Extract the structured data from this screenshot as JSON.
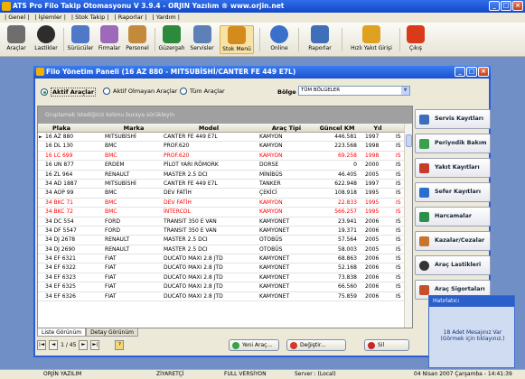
{
  "app": {
    "title": "ATS Pro Filo Takip Otomasyonu V 3.9.4 - ORJIN Yazılım ® www.orjin.net"
  },
  "window_buttons": [
    "_",
    "□",
    "×"
  ],
  "menu": [
    "| Genel |",
    "| İşlemler |",
    "| Stok Takip |",
    "| Raporlar |",
    "| Yardım |"
  ],
  "toolbar": [
    {
      "label": "Araçlar",
      "color": "#6e6e6e"
    },
    {
      "label": "Lastikler",
      "color": "#2d2d2d"
    },
    {
      "label": "Sürücüler",
      "color": "#4f79c8"
    },
    {
      "label": "Firmalar",
      "color": "#9c6ab8"
    },
    {
      "label": "Personel",
      "color": "#c48a3c"
    },
    {
      "label": "Güzergah",
      "color": "#2d8a3c"
    },
    {
      "label": "Servisler",
      "color": "#5d80b7"
    },
    {
      "label": "Stok Menü",
      "color": "#d48b1e"
    },
    {
      "label": "Online",
      "color": "#3a70c9"
    },
    {
      "label": "Raporlar",
      "color": "#3f6fb8"
    },
    {
      "label": "Hızlı Yakıt Girişi",
      "color": "#e0a020"
    },
    {
      "label": "Çıkış",
      "color": "#d83a1a"
    }
  ],
  "panel": {
    "title": "Filo Yönetim Paneli (16 AZ 880 - MITSUBİSHİ/CANTER FE 449 E7L)"
  },
  "filter": {
    "options": [
      "Aktif Araçlar",
      "Aktif Olmayan Araçlar",
      "Tüm Araçlar"
    ],
    "selected": "Aktif Araçlar",
    "bolge_label": "Bölge",
    "bolge_value": "TÜM BÖLGELER"
  },
  "grid": {
    "group_hint": "Gruplamak istediğiniz kolonu buraya sürükleyin",
    "columns": [
      "Plaka",
      "Marka",
      "Model",
      "Araç Tipi",
      "Güncel KM",
      "Yıl",
      ""
    ],
    "rows": [
      {
        "plaka": "16 AZ 880",
        "marka": "MITSUBİSHİ",
        "model": "CANTER FE 449 E7L",
        "tip": "KAMYON",
        "km": "446.581",
        "yil": "1997",
        "x": "IS",
        "red": false
      },
      {
        "plaka": "16 DL 130",
        "marka": "BMC",
        "model": "PROF.620",
        "tip": "KAMYON",
        "km": "223.568",
        "yil": "1998",
        "x": "IS",
        "red": false
      },
      {
        "plaka": "16 LC 699",
        "marka": "BMC",
        "model": "PROF.620",
        "tip": "KAMYON",
        "km": "69.258",
        "yil": "1998",
        "x": "IS",
        "red": true
      },
      {
        "plaka": "16 UN 877",
        "marka": "ERDEM",
        "model": "PİLOT YARI RÖMORK",
        "tip": "DORSE",
        "km": "0",
        "yil": "2000",
        "x": "IS",
        "red": false
      },
      {
        "plaka": "16 ZL 964",
        "marka": "RENAULT",
        "model": "MASTER 2.5 DCI",
        "tip": "MİNİBÜS",
        "km": "46.405",
        "yil": "2005",
        "x": "IS",
        "red": false
      },
      {
        "plaka": "34 AD 1887",
        "marka": "MITSUBİSHİ",
        "model": "CANTER FE 449 E7L",
        "tip": "TANKER",
        "km": "622.948",
        "yil": "1997",
        "x": "IS",
        "red": false
      },
      {
        "plaka": "34 AOP 99",
        "marka": "BMC",
        "model": "DEV FATİH",
        "tip": "ÇEKİCİ",
        "km": "108.918",
        "yil": "1995",
        "x": "IS",
        "red": false
      },
      {
        "plaka": "34 BKC 71",
        "marka": "BMC",
        "model": "DEV FATİH",
        "tip": "KAMYON",
        "km": "22.833",
        "yil": "1995",
        "x": "IS",
        "red": true
      },
      {
        "plaka": "34 BKC 72",
        "marka": "BMC",
        "model": "İNTERCOL",
        "tip": "KAMYON",
        "km": "566.257",
        "yil": "1995",
        "x": "IS",
        "red": true
      },
      {
        "plaka": "34 DC 554",
        "marka": "FORD",
        "model": "TRANSIT 350 E VAN",
        "tip": "KAMYONET",
        "km": "23.941",
        "yil": "2006",
        "x": "IS",
        "red": false
      },
      {
        "plaka": "34 DF 5547",
        "marka": "FORD",
        "model": "TRANSIT 350 E VAN",
        "tip": "KAMYONET",
        "km": "19.371",
        "yil": "2006",
        "x": "IS",
        "red": false
      },
      {
        "plaka": "34 DJ 2678",
        "marka": "RENAULT",
        "model": "MASTER 2.5 DCI",
        "tip": "OTOBÜS",
        "km": "57.564",
        "yil": "2005",
        "x": "IS",
        "red": false
      },
      {
        "plaka": "34 DJ 2690",
        "marka": "RENAULT",
        "model": "MASTER 2.5 DCI",
        "tip": "OTOBÜS",
        "km": "58.003",
        "yil": "2005",
        "x": "IS",
        "red": false
      },
      {
        "plaka": "34 EF 6321",
        "marka": "FIAT",
        "model": "DUCATO MAXI 2.8 JTD",
        "tip": "KAMYONET",
        "km": "68.863",
        "yil": "2006",
        "x": "IS",
        "red": false
      },
      {
        "plaka": "34 EF 6322",
        "marka": "FIAT",
        "model": "DUCATO MAXI 2.8 JTD",
        "tip": "KAMYONET",
        "km": "52.168",
        "yil": "2006",
        "x": "IS",
        "red": false
      },
      {
        "plaka": "34 EF 6323",
        "marka": "FIAT",
        "model": "DUCATO MAXI 2.8 JTD",
        "tip": "KAMYONET",
        "km": "73.838",
        "yil": "2006",
        "x": "IS",
        "red": false
      },
      {
        "plaka": "34 EF 6325",
        "marka": "FIAT",
        "model": "DUCATO MAXI 2.8 JTD",
        "tip": "KAMYONET",
        "km": "66.560",
        "yil": "2006",
        "x": "IS",
        "red": false
      },
      {
        "plaka": "34 EF 6326",
        "marka": "FIAT",
        "model": "DUCATO MAXI 2.8 JTD",
        "tip": "KAMYONET",
        "km": "75.859",
        "yil": "2006",
        "x": "IS",
        "red": false
      }
    ]
  },
  "tabs": [
    "Liste Görünüm",
    "Detay Görünüm"
  ],
  "nav": {
    "first": "|◄",
    "prev": "◄",
    "page": "1 / 45",
    "next": "►",
    "last": "►|",
    "help": "?"
  },
  "actions": {
    "new": "Yeni Araç...",
    "edit": "Değiştir...",
    "delete": "Sil"
  },
  "side_buttons": [
    {
      "label": "Servis Kayıtları",
      "color": "#3c6dbd"
    },
    {
      "label": "Periyodik Bakım",
      "color": "#3aa04e"
    },
    {
      "label": "Yakıt Kayıtları",
      "color": "#c83a2a"
    },
    {
      "label": "Sefer Kayıtları",
      "color": "#2a6ed0"
    },
    {
      "label": "Harcamalar",
      "color": "#2d9048"
    },
    {
      "label": "Kazalar/Cezalar",
      "color": "#c8742a"
    },
    {
      "label": "Araç Lastikleri",
      "color": "#333333"
    },
    {
      "label": "Araç Sigortaları",
      "color": "#c74e2a"
    }
  ],
  "notification": {
    "title": "Hatırlatıcı",
    "message": "18 Adet Mesajınız Var (Görmek için tıklayınız.)"
  },
  "status": {
    "company": "ORJİN YAZILIM",
    "edition": "ZİYARETÇİ",
    "version": "FULL VERSİYON",
    "server": "Server : (Local)",
    "datetime": "04 Nisan 2007 Çarşamba - 14:41:39"
  }
}
